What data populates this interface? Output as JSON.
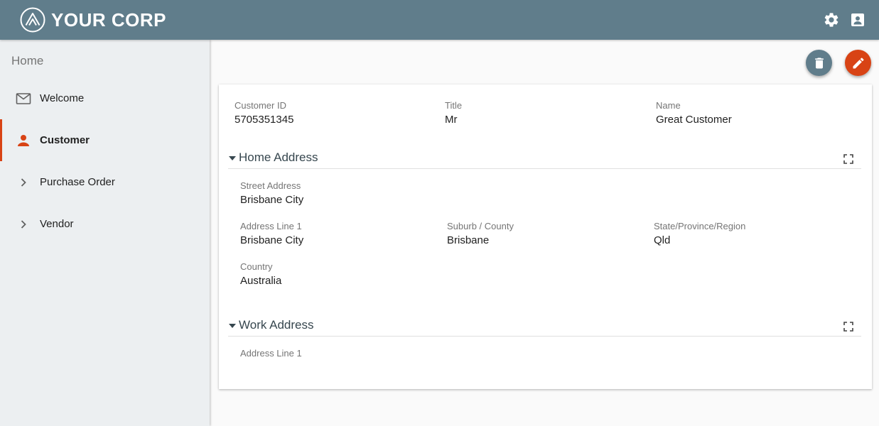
{
  "header": {
    "brand_name": "YOUR CORP",
    "logo_icon": "triangle-logo-icon",
    "settings_icon": "gear-icon",
    "account_icon": "contact-card-icon",
    "color": "#607d8b"
  },
  "sidebar": {
    "title": "Home",
    "items": [
      {
        "label": "Welcome",
        "icon": "mail-icon",
        "active": false
      },
      {
        "label": "Customer",
        "icon": "person-icon",
        "active": true
      },
      {
        "label": "Purchase Order",
        "icon": "chevron-right-icon",
        "active": false
      },
      {
        "label": "Vendor",
        "icon": "chevron-right-icon",
        "active": false
      }
    ],
    "accent_color": "#d84315"
  },
  "actions": {
    "delete_icon": "trash-icon",
    "edit_icon": "pencil-icon",
    "delete_color": "#607d8b",
    "edit_color": "#d84315"
  },
  "customer": {
    "id_label": "Customer ID",
    "id_value": "5705351345",
    "title_label": "Title",
    "title_value": "Mr",
    "name_label": "Name",
    "name_value": "Great Customer"
  },
  "home_address": {
    "title": "Home Address",
    "street_label": "Street Address",
    "street_value": "Brisbane City",
    "line1_label": "Address Line 1",
    "line1_value": "Brisbane City",
    "suburb_label": "Suburb / County",
    "suburb_value": "Brisbane",
    "state_label": "State/Province/Region",
    "state_value": "Qld",
    "country_label": "Country",
    "country_value": "Australia"
  },
  "work_address": {
    "title": "Work Address",
    "line1_label": "Address Line 1"
  }
}
